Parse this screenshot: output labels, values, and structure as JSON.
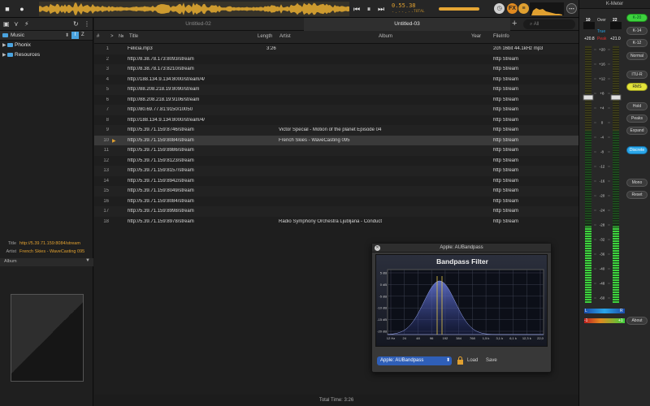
{
  "transport": {
    "time": "0.55.38",
    "time_sub": "-.--.--",
    "total_label": "TOTAL",
    "fx_label": "FX"
  },
  "left": {
    "folder_label": "Music",
    "col_i": "I",
    "col_z": "Z",
    "tree": [
      {
        "label": "Phonix"
      },
      {
        "label": "Resources"
      }
    ],
    "info": [
      {
        "key": "Title",
        "value": "http://5.39.71.159:8084/stream"
      },
      {
        "key": "Artist",
        "value": "French Skies - WaveCasting 095"
      }
    ],
    "album_label": "Album"
  },
  "tabs": [
    {
      "label": "Untitled-02"
    },
    {
      "label": "Untitled-03"
    }
  ],
  "search_placeholder": "All",
  "playlist": {
    "columns": {
      "num": "#",
      "sort": ">",
      "no": "№",
      "title": "Title",
      "length": "Length",
      "artist": "Artist",
      "album": "Album",
      "year": "Year",
      "info": "FileInfo"
    },
    "rows": [
      {
        "n": "1",
        "title": "Felicia.mp3",
        "length": "3:26",
        "artist": "",
        "info": "2ch 16bit 44.1kHz mp3"
      },
      {
        "n": "2",
        "title": "http://8.38.78.173:8093/stream",
        "length": "",
        "artist": "",
        "info": "http Stream"
      },
      {
        "n": "3",
        "title": "http://8.38.78.173:8210/stream",
        "length": "",
        "artist": "",
        "info": "http Stream"
      },
      {
        "n": "4",
        "title": "http://188.134.9.134:8000/stream/4/",
        "length": "",
        "artist": "",
        "info": "http Stream"
      },
      {
        "n": "5",
        "title": "http://88.208.218.19:8090/stream",
        "length": "",
        "artist": "",
        "info": "http Stream"
      },
      {
        "n": "6",
        "title": "http://88.208.218.19:9106/stream",
        "length": "",
        "artist": "",
        "info": "http Stream"
      },
      {
        "n": "7",
        "title": "http://80.69.77.81:9150/10050",
        "length": "",
        "artist": "",
        "info": "http Stream"
      },
      {
        "n": "8",
        "title": "http://188.134.9.134:8000/stream/4/",
        "length": "",
        "artist": "",
        "info": "http Stream"
      },
      {
        "n": "9",
        "title": "http://5.39.71.159:8746/stream",
        "length": "",
        "artist": "Victor Special - Motion of the planet Episode 04",
        "info": "http Stream"
      },
      {
        "n": "10",
        "title": "http://5.39.71.159:8084/stream",
        "length": "",
        "artist": "French Skies - WaveCasting 095",
        "info": "http Stream",
        "selected": true
      },
      {
        "n": "11",
        "title": "http://5.39.71.159:8986/stream",
        "length": "",
        "artist": "",
        "info": "http Stream"
      },
      {
        "n": "12",
        "title": "http://5.39.71.159:8123/stream",
        "length": "",
        "artist": "",
        "info": "http Stream"
      },
      {
        "n": "13",
        "title": "http://5.39.71.159:8157/stream",
        "length": "",
        "artist": "",
        "info": "http Stream"
      },
      {
        "n": "14",
        "title": "http://5.39.71.159:8942/stream",
        "length": "",
        "artist": "",
        "info": "http Stream"
      },
      {
        "n": "15",
        "title": "http://5.39.71.159:8049/stream",
        "length": "",
        "artist": "",
        "info": "http Stream"
      },
      {
        "n": "16",
        "title": "http://5.39.71.159:8084/stream",
        "length": "",
        "artist": "",
        "info": "http Stream"
      },
      {
        "n": "17",
        "title": "http://5.39.71.159:8998/stream",
        "length": "",
        "artist": "",
        "info": "http Stream"
      },
      {
        "n": "18",
        "title": "http://5.39.71.159:8978/stream",
        "length": "",
        "artist": "Radio Symphony Orchestra Ljubljana - Conduct",
        "info": "http Stream"
      }
    ],
    "total": "Total Time: 3:26"
  },
  "au": {
    "title": "Apple: AUBandpass",
    "panel_title": "Bandpass Filter",
    "db_ticks": [
      "5 dB",
      "0 dB",
      "-5 dB",
      "-10 dB",
      "-15 dB",
      "-20 dB"
    ],
    "freq_ticks": [
      "12 Hz",
      "24",
      "48",
      "96",
      "192",
      "384",
      "768",
      "1,5 k",
      "3,1 k",
      "6,1 k",
      "12,3 k",
      "22,0"
    ],
    "preset": "Apple: AUBandpass",
    "load": "Load",
    "save": "Save"
  },
  "kmeter": {
    "title": "K-Meter",
    "left_val": "10",
    "over_label": "Over",
    "right_val": "22",
    "true_label": "True",
    "peak_left": "+20.8",
    "peak_label": "Peak",
    "peak_right": "+21.0",
    "scale": [
      "+20",
      "+16",
      "+12",
      "+8",
      "+4",
      "0",
      "-4",
      "-8",
      "-12",
      "-16",
      "-20",
      "-24",
      "-28",
      "-32",
      "-36",
      "-40",
      "-48",
      "-60"
    ],
    "buttons": {
      "k20": "K-20",
      "k14": "K-14",
      "k12": "K-12",
      "normal": "Normal",
      "itur": "ITU-R",
      "rms": "RMS",
      "hold": "Hold",
      "peaks": "Peaks",
      "expand": "Expand",
      "discrete": "Discrete",
      "mono": "Mono",
      "reset": "Reset",
      "about": "About"
    },
    "bal_l": "L",
    "bal_r": "R",
    "corr_l": "-1",
    "corr_r": "+1"
  },
  "colors": {
    "accent": "#e0a030",
    "meter_green": "#3ed23e",
    "meter_red": "#e03030",
    "preset_blue": "#2f5fb8"
  }
}
